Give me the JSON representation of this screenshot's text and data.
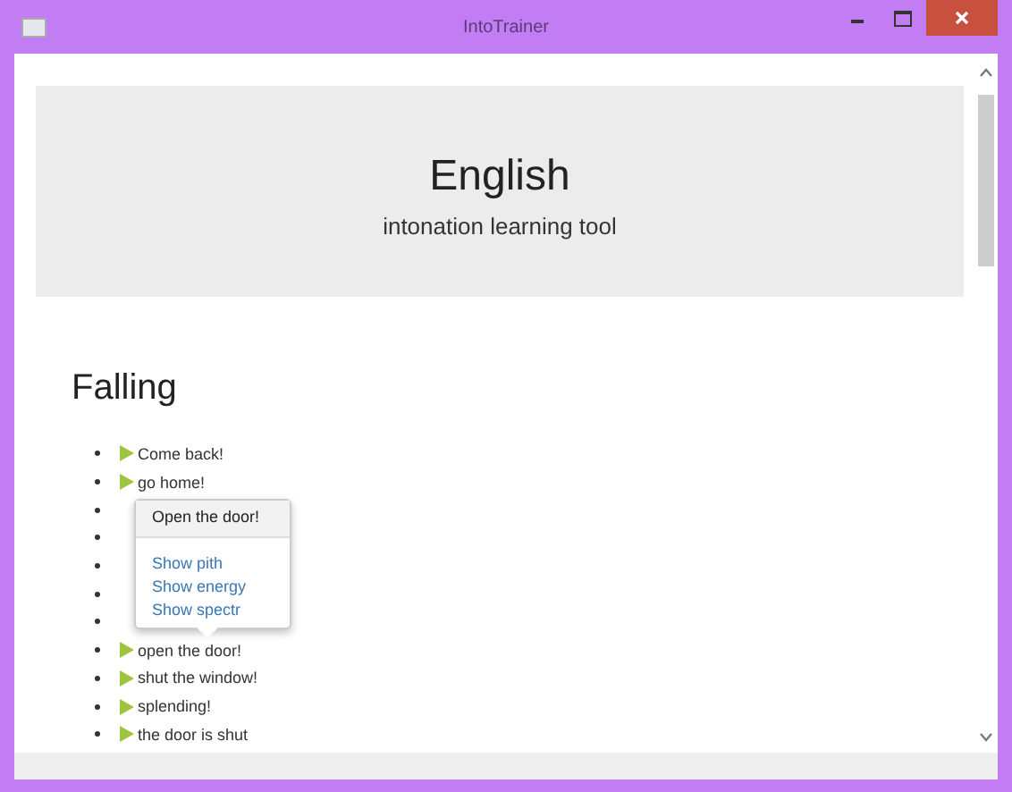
{
  "window": {
    "title": "IntoTrainer"
  },
  "header": {
    "title": "English",
    "subtitle": "intonation learning tool"
  },
  "section": {
    "title": "Falling"
  },
  "phrases": [
    {
      "label": "Come back!"
    },
    {
      "label": "go home!"
    },
    {
      "covered": true
    },
    {
      "covered": true
    },
    {
      "covered": true
    },
    {
      "covered": true
    },
    {
      "covered": true
    },
    {
      "label": "open the door!"
    },
    {
      "label": "shut the window!"
    },
    {
      "label": "splending!"
    },
    {
      "label": "the door is shut"
    }
  ],
  "popup": {
    "title": "Open the door!",
    "links": [
      "Show pith",
      "Show energy",
      "Show spectr"
    ]
  }
}
